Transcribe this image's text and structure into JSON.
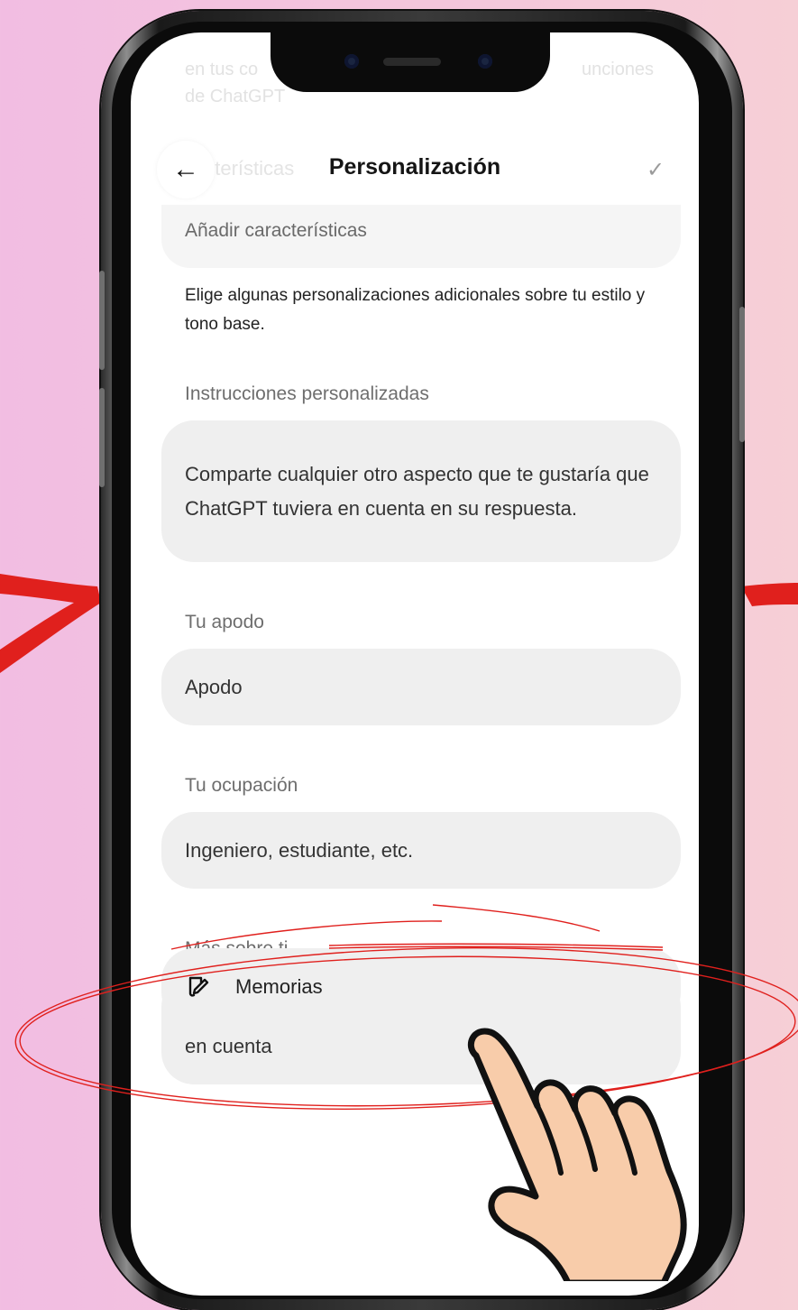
{
  "header": {
    "title": "Personalización",
    "back_icon": "←",
    "check_icon": "✓",
    "faded_word": "acterísticas"
  },
  "background_text": {
    "line1_left": "en tus co",
    "line1_right": "unciones",
    "line2": "de ChatGPT"
  },
  "traits": {
    "placeholder": "Añadir características",
    "description": "Elige algunas personalizaciones adicionales sobre tu estilo y tono base."
  },
  "custom_instructions": {
    "label": "Instrucciones personalizadas",
    "placeholder": "Comparte cualquier otro aspecto que te gustaría que ChatGPT tuviera en cuenta en su respuesta."
  },
  "nickname": {
    "label": "Tu apodo",
    "placeholder": "Apodo"
  },
  "occupation": {
    "label": "Tu ocupación",
    "placeholder": "Ingeniero, estudiante, etc."
  },
  "more_about_you": {
    "label": "Más sobre ti",
    "placeholder": "Intereses, valores o preferencias que se deban tener en cuenta"
  },
  "memories": {
    "label": "Memorias",
    "icon": "memory-icon"
  },
  "colors": {
    "annotation_red": "#e0201d",
    "field_bg": "#efefef"
  }
}
